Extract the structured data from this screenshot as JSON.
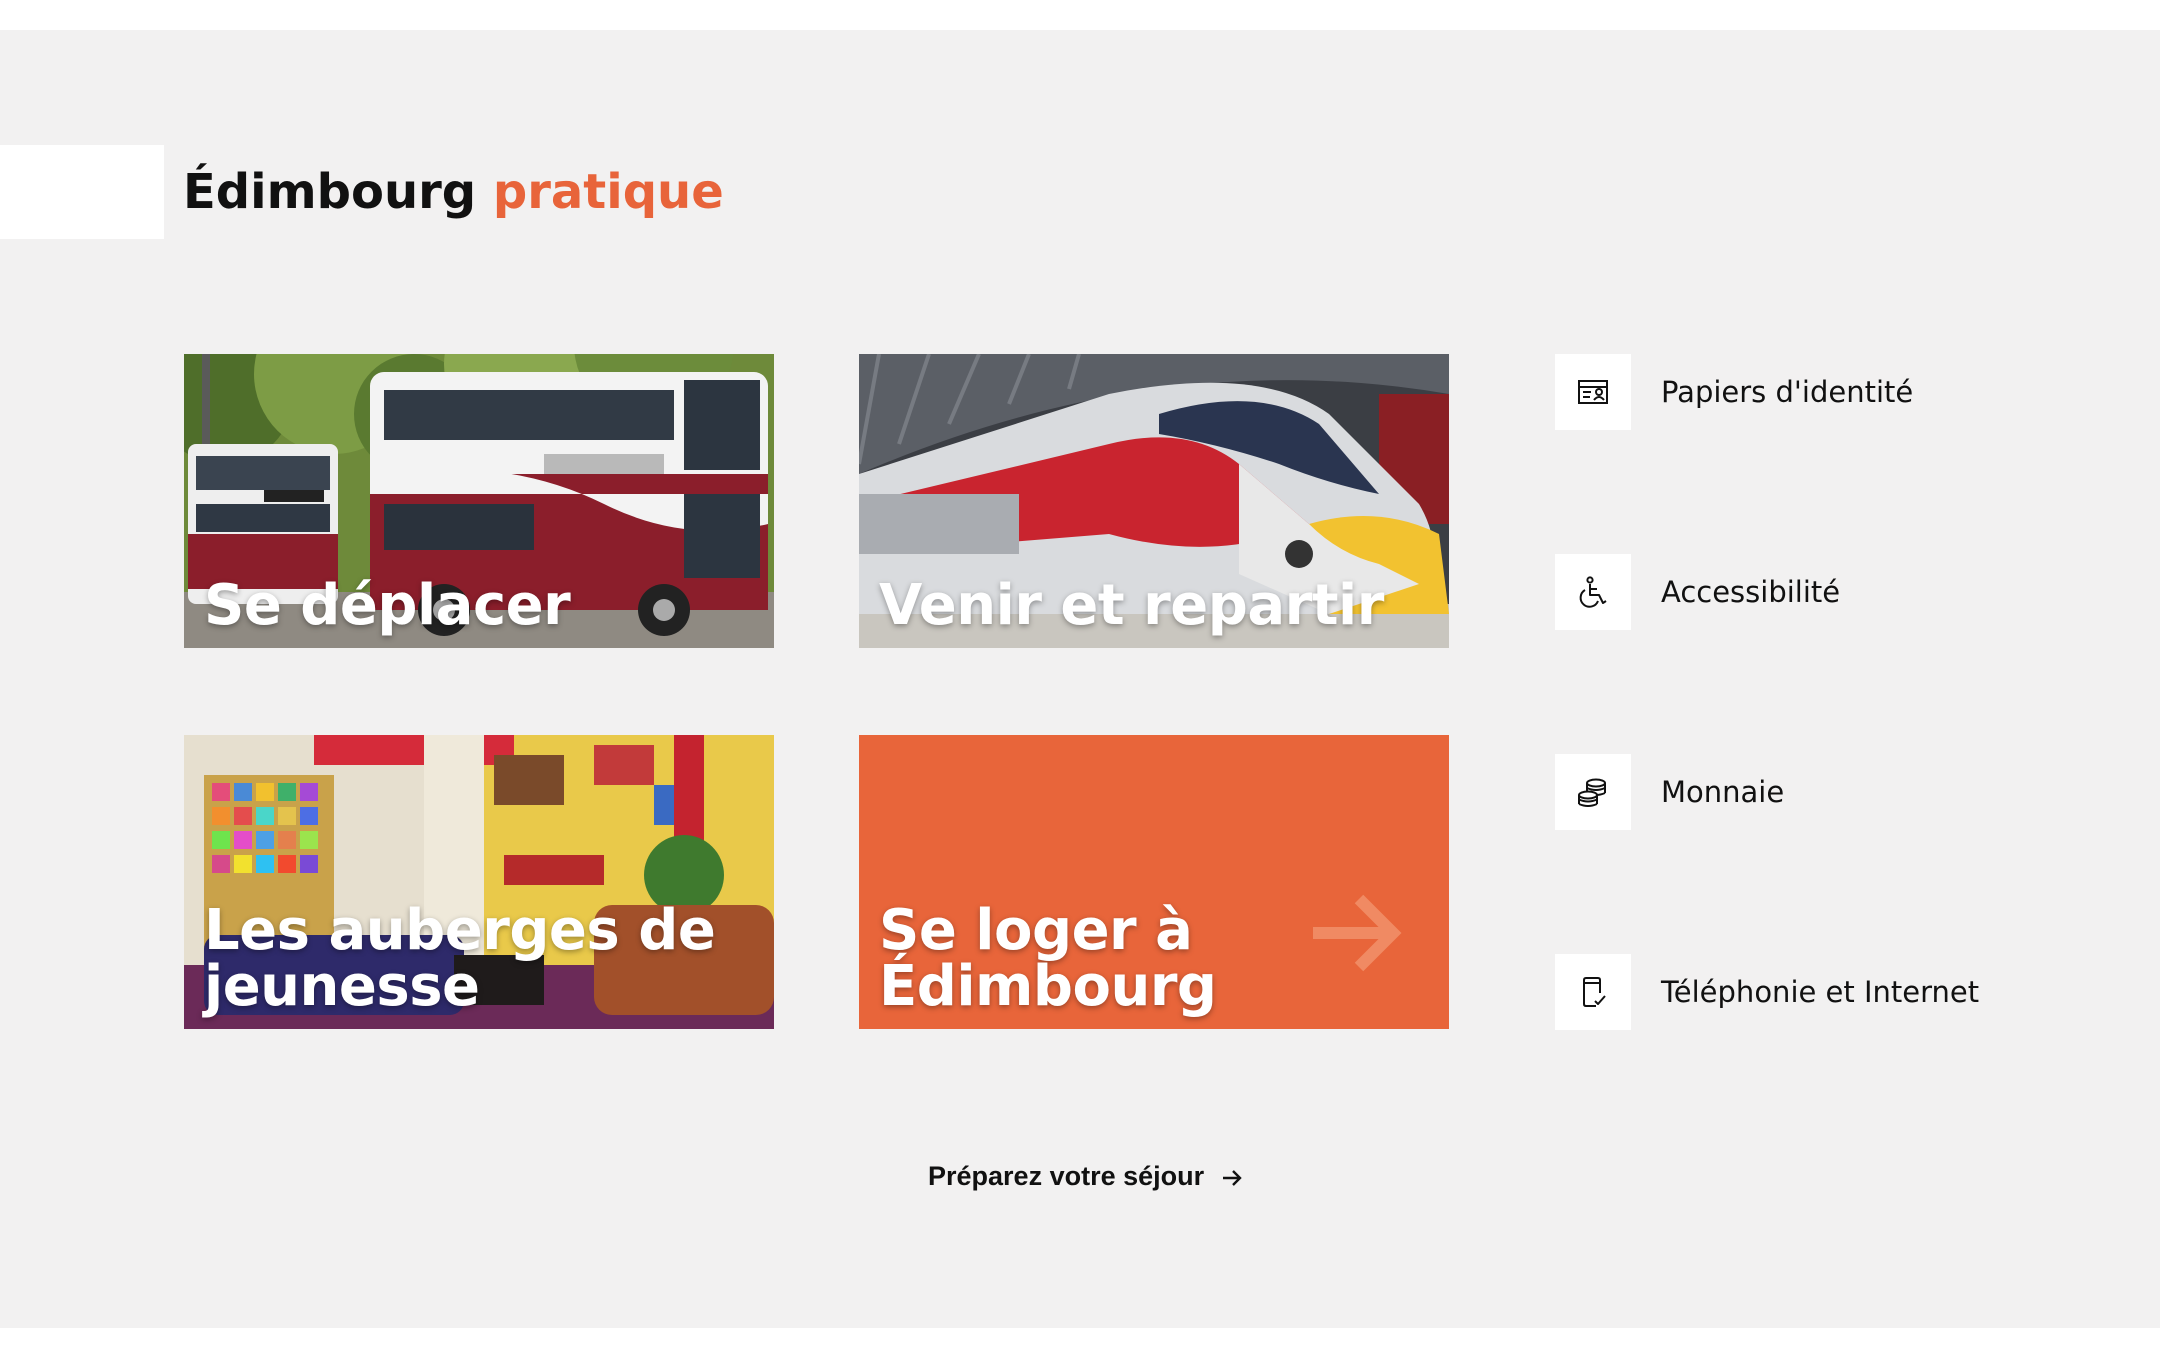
{
  "section": {
    "title_main": "Édimbourg",
    "title_accent": "pratique",
    "accent_color": "#e8643a",
    "background_color": "#f2f1f1"
  },
  "cards": [
    {
      "label": "Se déplacer",
      "image": "double-decker-buses-photo"
    },
    {
      "label": "Venir et repartir",
      "image": "lner-azuma-train-photo"
    },
    {
      "label": "Les auberges de jeunesse",
      "image": "hostel-lounge-photo"
    },
    {
      "label": "Se loger à Édimbourg",
      "icon": "arrow-right-icon",
      "color": "#e8653a"
    }
  ],
  "side_links": [
    {
      "label": "Papiers d'identité",
      "icon": "id-card-icon"
    },
    {
      "label": "Accessibilité",
      "icon": "wheelchair-icon"
    },
    {
      "label": "Monnaie",
      "icon": "coins-icon"
    },
    {
      "label": "Téléphonie et Internet",
      "icon": "phone-check-icon"
    }
  ],
  "footer_link": {
    "label": "Préparez votre séjour",
    "icon": "arrow-right-icon"
  }
}
